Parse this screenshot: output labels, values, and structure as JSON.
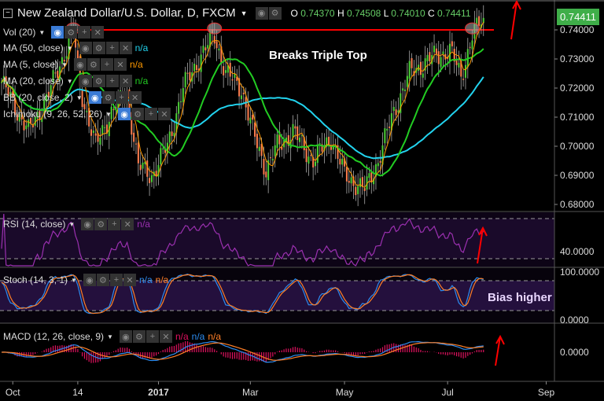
{
  "header": {
    "title": "New Zealand Dollar/U.S. Dollar, D, FXCM",
    "ohlc": {
      "o_label": "O",
      "o": "0.74370",
      "h_label": "H",
      "h": "0.74508",
      "l_label": "L",
      "l": "0.74010",
      "c_label": "C",
      "c": "0.74411"
    },
    "last_price": "0.74411"
  },
  "indicators": {
    "vol": "Vol (20)",
    "ma50": "MA (50, close)",
    "ma50_val": "n/a",
    "ma5": "MA (5, close)",
    "ma5_val": "n/a",
    "ma20": "MA (20, close)",
    "ma20_val": "n/a",
    "bb": "BB (20, close, 2)",
    "ichimoku": "Ichimoku (9, 26, 52, 26)",
    "rsi": "RSI (14, close)",
    "rsi_val": "n/a",
    "stoch": "Stoch (14, 3, 1)",
    "stoch_k": "n/a",
    "stoch_d": "n/a",
    "macd": "MACD (12, 26, close, 9)",
    "macd_a": "n/a",
    "macd_b": "n/a",
    "macd_c": "n/a"
  },
  "annotations": {
    "triple_top": "Breaks Triple Top",
    "bias": "Bias higher"
  },
  "colors": {
    "up": "#4cd137",
    "down": "#ff7f50",
    "ma50": "#22d3ee",
    "ma20": "#22cc22",
    "ma5": "#ff9900",
    "resistance": "#ff0000",
    "rsi": "#9b30b0",
    "stoch_k": "#2d8cf0",
    "stoch_d": "#ff7f27"
  },
  "chart_data": {
    "type": "candlestick",
    "price_axis": {
      "ticks": [
        "0.74000",
        "0.73000",
        "0.72000",
        "0.71000",
        "0.70000",
        "0.69000",
        "0.68000"
      ],
      "range": [
        0.6765,
        0.7495
      ]
    },
    "rsi_axis": {
      "ticks": [
        "40.0000"
      ]
    },
    "stoch_axis": {
      "ticks": [
        "100.0000",
        "0.0000"
      ]
    },
    "macd_axis": {
      "ticks": [
        "0.0000"
      ]
    },
    "x_ticks": [
      {
        "label": "Oct",
        "bar": 5
      },
      {
        "label": "14",
        "bar": 34
      },
      {
        "label": "2017",
        "bar": 70
      },
      {
        "label": "Mar",
        "bar": 111
      },
      {
        "label": "May",
        "bar": 153
      },
      {
        "label": "Jul",
        "bar": 199
      },
      {
        "label": "Sep",
        "bar": 243
      }
    ],
    "resistance": 0.74,
    "close_keypoints": [
      [
        0,
        0.722
      ],
      [
        12,
        0.705
      ],
      [
        21,
        0.718
      ],
      [
        32,
        0.74
      ],
      [
        35,
        0.72
      ],
      [
        42,
        0.7
      ],
      [
        49,
        0.712
      ],
      [
        56,
        0.718
      ],
      [
        61,
        0.693
      ],
      [
        67,
        0.69
      ],
      [
        74,
        0.7
      ],
      [
        81,
        0.72
      ],
      [
        88,
        0.73
      ],
      [
        95,
        0.738
      ],
      [
        100,
        0.725
      ],
      [
        107,
        0.72
      ],
      [
        112,
        0.705
      ],
      [
        118,
        0.692
      ],
      [
        123,
        0.7
      ],
      [
        130,
        0.705
      ],
      [
        139,
        0.695
      ],
      [
        147,
        0.703
      ],
      [
        153,
        0.69
      ],
      [
        162,
        0.685
      ],
      [
        168,
        0.695
      ],
      [
        175,
        0.712
      ],
      [
        182,
        0.725
      ],
      [
        191,
        0.73
      ],
      [
        200,
        0.733
      ],
      [
        205,
        0.724
      ],
      [
        210,
        0.738
      ],
      [
        215,
        0.7441
      ]
    ]
  }
}
